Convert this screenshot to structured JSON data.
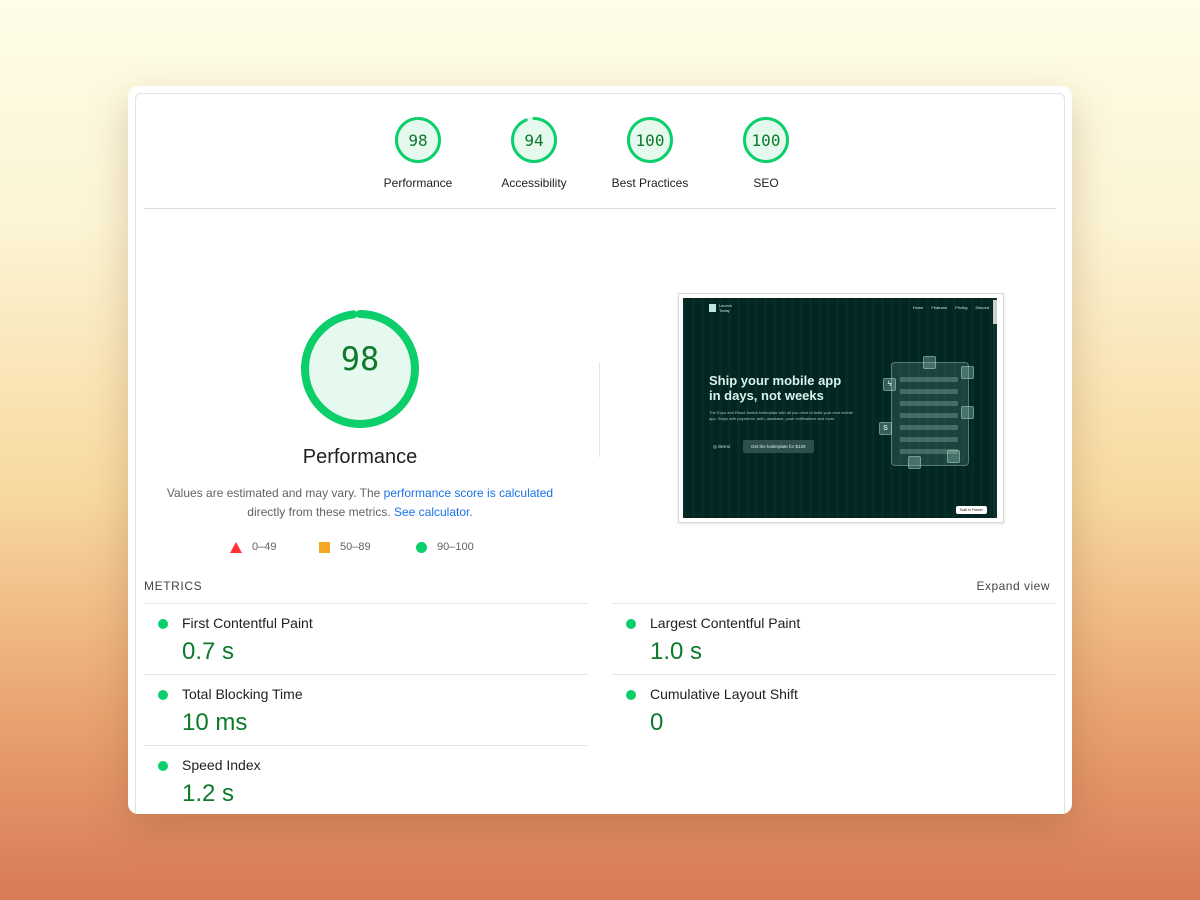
{
  "summary": {
    "gauges": [
      {
        "score": 98,
        "label": "Performance"
      },
      {
        "score": 94,
        "label": "Accessibility"
      },
      {
        "score": 100,
        "label": "Best Practices"
      },
      {
        "score": 100,
        "label": "SEO"
      }
    ]
  },
  "performance": {
    "score": 98,
    "title": "Performance",
    "desc_prefix": "Values are estimated and may vary. The ",
    "desc_link1": "performance score is calculated",
    "desc_middle": " directly from these metrics. ",
    "desc_link2": "See calculator.",
    "legend": [
      {
        "range": "0–49",
        "shape": "triangle",
        "color": "#ff3333"
      },
      {
        "range": "50–89",
        "shape": "square",
        "color": "#f5a623"
      },
      {
        "range": "90–100",
        "shape": "circle",
        "color": "#0cce6b"
      }
    ]
  },
  "screenshot": {
    "logo": "Launch Today",
    "nav": [
      "Home",
      "Features",
      "Pricing",
      "Discord"
    ],
    "hero_line1": "Ship your mobile app",
    "hero_line2": "in days, not weeks",
    "hero_sub": "The Expo and React Native boilerplate with all you need to build your next mobile app. Ships with payments, auth, database, push notifications and more.",
    "demo": "Demo",
    "cta": "Get the boilerplate for $129",
    "badge": "Built in Framer"
  },
  "metrics": {
    "heading": "METRICS",
    "expand": "Expand view",
    "items": [
      {
        "label": "First Contentful Paint",
        "value": "0.7 s"
      },
      {
        "label": "Largest Contentful Paint",
        "value": "1.0 s"
      },
      {
        "label": "Total Blocking Time",
        "value": "10 ms"
      },
      {
        "label": "Cumulative Layout Shift",
        "value": "0"
      },
      {
        "label": "Speed Index",
        "value": "1.2 s"
      }
    ]
  },
  "colors": {
    "pass": "#0cce6b",
    "pass_text": "#0c7a2a",
    "pass_fill": "#e6f9ee",
    "link": "#1a73e8"
  }
}
